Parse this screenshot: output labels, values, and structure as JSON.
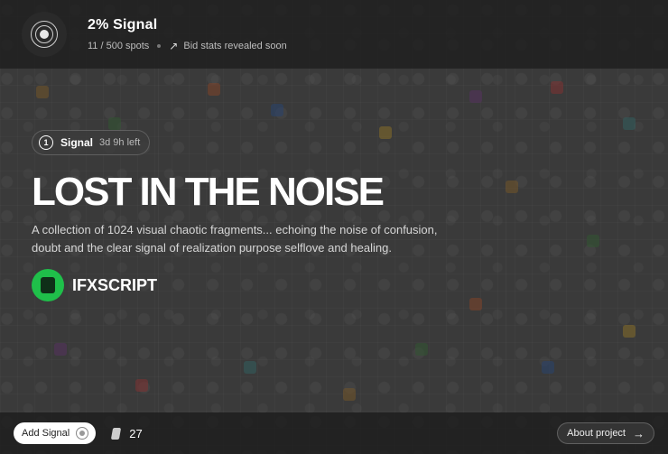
{
  "header": {
    "project_name": "2% Signal",
    "spots": "11 / 500 spots",
    "bid_stats": "Bid stats revealed soon",
    "trend_icon": "↗"
  },
  "hero": {
    "pill_number": "1",
    "pill_label": "Signal",
    "pill_time": "3d 9h left",
    "title": "LOST IN THE NOISE",
    "description": "A collection of 1024 visual chaotic fragments... echoing the noise of confusion, doubt and the clear signal of realization purpose selflove and healing.",
    "artist": "IFXSCRIPT"
  },
  "footer": {
    "add_signal": "Add Signal",
    "count": "27",
    "about": "About project",
    "about_arrow": "→"
  },
  "colors": {
    "accent_green": "#1fbf4a",
    "bar_bg": "#1e1e1e"
  }
}
